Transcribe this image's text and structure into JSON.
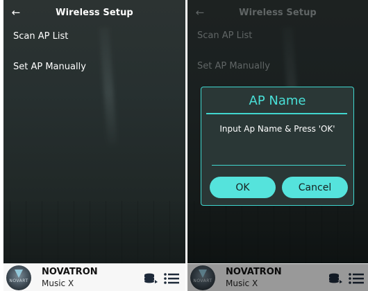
{
  "left_screen": {
    "header": {
      "back_icon": "←",
      "title": "Wireless Setup"
    },
    "menu": {
      "scan_ap_list": "Scan AP List",
      "set_ap_manually": "Set AP Manually"
    },
    "footer": {
      "logo_text": "NOVART",
      "brand": "NOVATRON",
      "model": "Music X",
      "icons": [
        "database-icon",
        "list-icon"
      ]
    }
  },
  "right_screen": {
    "header": {
      "back_icon": "←",
      "title": "Wireless Setup"
    },
    "menu": {
      "scan_ap_list": "Scan AP List",
      "set_ap_manually": "Set AP Manually"
    },
    "dialog": {
      "title": "AP Name",
      "message": "Input Ap Name & Press 'OK'",
      "input_value": "",
      "ok_label": "OK",
      "cancel_label": "Cancel"
    },
    "footer": {
      "logo_text": "NOVART",
      "brand": "NOVATRON",
      "model": "Music X",
      "icons": [
        "database-icon",
        "list-icon"
      ]
    }
  },
  "colors": {
    "accent": "#49e0d8",
    "button": "#55e3dc",
    "dialog_bg": "#2a3736",
    "app_bg": "#273030",
    "footer_bg": "#f7f7f7"
  }
}
